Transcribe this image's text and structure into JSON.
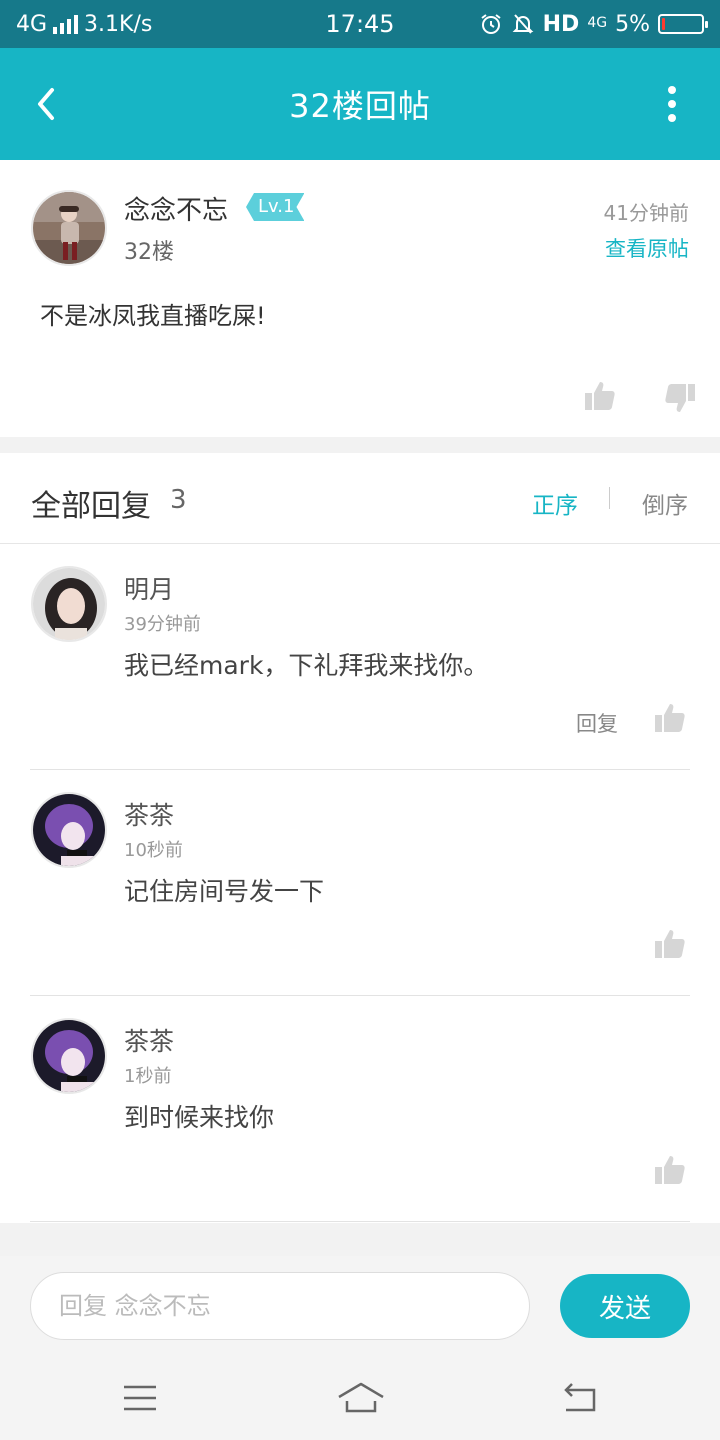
{
  "status_bar": {
    "network": "4G",
    "speed": "3.1K/s",
    "time": "17:45",
    "hd": "HD",
    "network_right": "4G",
    "battery_percent": "5%",
    "battery_level": 0.05,
    "icons": [
      "signal-icon",
      "alarm-icon",
      "mute-bell-icon",
      "battery-icon"
    ]
  },
  "header": {
    "title": "32楼回帖",
    "back_icon": "back-arrow-icon",
    "more_icon": "more-vertical-icon"
  },
  "post": {
    "username": "念念不忘",
    "level": "Lv.1",
    "floor": "32楼",
    "time": "41分钟前",
    "view_original": "查看原帖",
    "content": "不是冰凤我直播吃屎!"
  },
  "replies": {
    "title": "全部回复",
    "count": "3",
    "sort_asc": "正序",
    "sort_desc": "倒序",
    "items": [
      {
        "name": "明月",
        "time": "39分钟前",
        "text": "我已经mark，下礼拜我来找你。",
        "reply_label": "回复"
      },
      {
        "name": "茶茶",
        "time": "10秒前",
        "text": "记住房间号发一下"
      },
      {
        "name": "茶茶",
        "time": "1秒前",
        "text": "到时候来找你"
      }
    ]
  },
  "input_bar": {
    "placeholder": "回复 念念不忘",
    "send_label": "发送"
  },
  "nav_bar": {
    "icons": [
      "menu-icon",
      "home-icon",
      "back-icon"
    ]
  },
  "colors": {
    "accent": "#17b5c5",
    "status_bar": "#16798a",
    "background": "#f2f2f2"
  }
}
